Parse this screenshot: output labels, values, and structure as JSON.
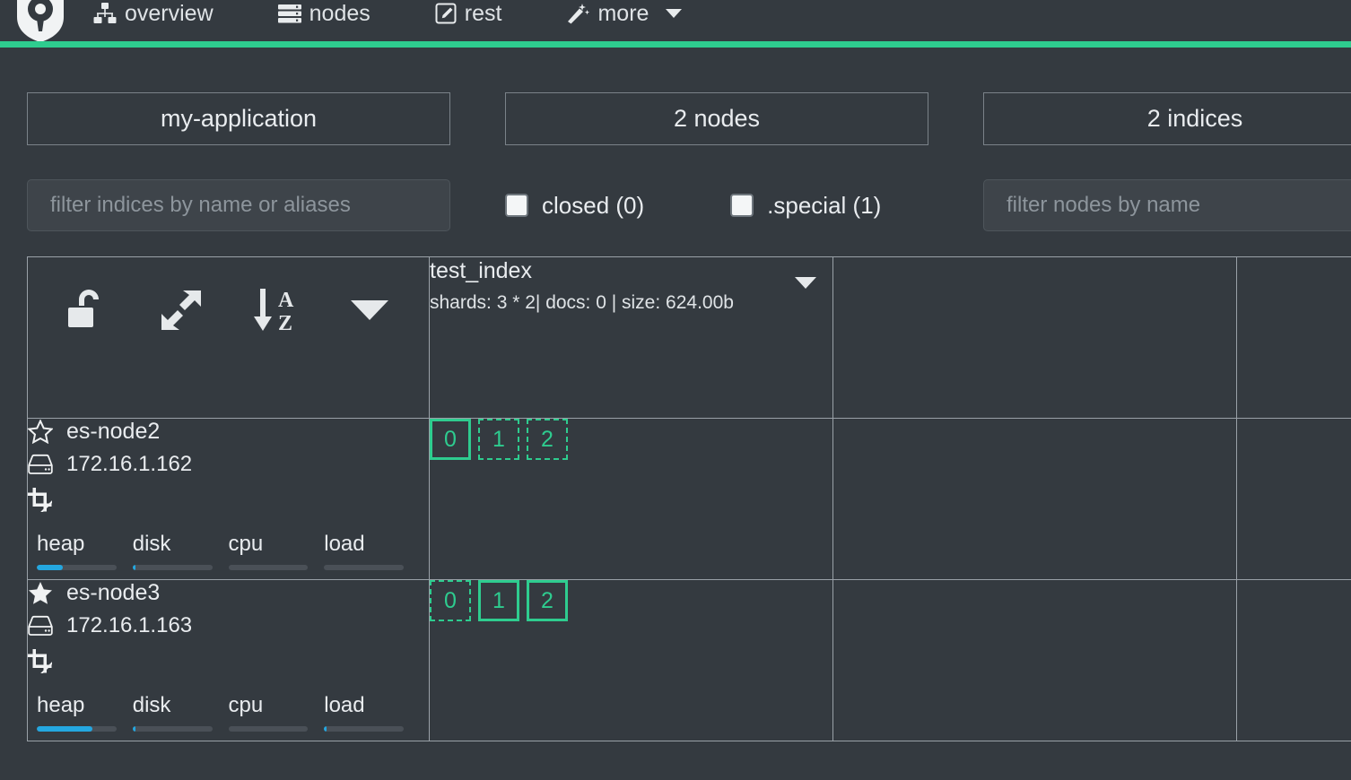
{
  "navbar": {
    "brand_icon": "cerebro-logo-icon",
    "items": [
      {
        "label": "overview",
        "icon": "sitemap-icon"
      },
      {
        "label": "nodes",
        "icon": "server-list-icon"
      },
      {
        "label": "rest",
        "icon": "pen-square-icon"
      },
      {
        "label": "more",
        "icon": "magic-wand-icon",
        "has_caret": true
      }
    ]
  },
  "accent_color": "#2ecc8f",
  "cards": [
    {
      "label": "my-application"
    },
    {
      "label": "2 nodes"
    },
    {
      "label": "2 indices"
    }
  ],
  "filters": {
    "index_filter_placeholder": "filter indices by name or aliases",
    "index_filter_value": "",
    "checkboxes": [
      {
        "label": "closed (0)",
        "checked": false
      },
      {
        "label": ".special (1)",
        "checked": false
      }
    ],
    "node_filter_placeholder": "filter nodes by name",
    "node_filter_value": ""
  },
  "toolbar": {
    "buttons": [
      {
        "name": "unlock-icon",
        "title": "unlock"
      },
      {
        "name": "expand-arrows-icon",
        "title": "expand"
      },
      {
        "name": "sort-alpha-asc-icon",
        "title": "sort a-z"
      },
      {
        "name": "caret-down-icon",
        "title": "more"
      }
    ]
  },
  "indices": [
    {
      "name": "test_index",
      "meta": "shards: 3 * 2| docs: 0 | size: 624.00b"
    }
  ],
  "nodes": [
    {
      "name": "es-node2",
      "master": false,
      "star_icon": "star-outline-icon",
      "ip": "172.16.1.162",
      "ip_icon": "hdd-icon",
      "role_icon": "crop-icon",
      "stats": [
        {
          "label": "heap",
          "percent": 33
        },
        {
          "label": "disk",
          "percent": 4
        },
        {
          "label": "cpu",
          "percent": 0
        },
        {
          "label": "load",
          "percent": 0
        }
      ],
      "shards": [
        {
          "label": "0",
          "type": "primary"
        },
        {
          "label": "1",
          "type": "replica"
        },
        {
          "label": "2",
          "type": "replica"
        }
      ]
    },
    {
      "name": "es-node3",
      "master": true,
      "star_icon": "star-filled-icon",
      "ip": "172.16.1.163",
      "ip_icon": "hdd-icon",
      "role_icon": "crop-icon",
      "stats": [
        {
          "label": "heap",
          "percent": 70
        },
        {
          "label": "disk",
          "percent": 4
        },
        {
          "label": "cpu",
          "percent": 0
        },
        {
          "label": "load",
          "percent": 3
        }
      ],
      "shards": [
        {
          "label": "0",
          "type": "replica"
        },
        {
          "label": "1",
          "type": "primary"
        },
        {
          "label": "2",
          "type": "primary"
        }
      ]
    }
  ]
}
